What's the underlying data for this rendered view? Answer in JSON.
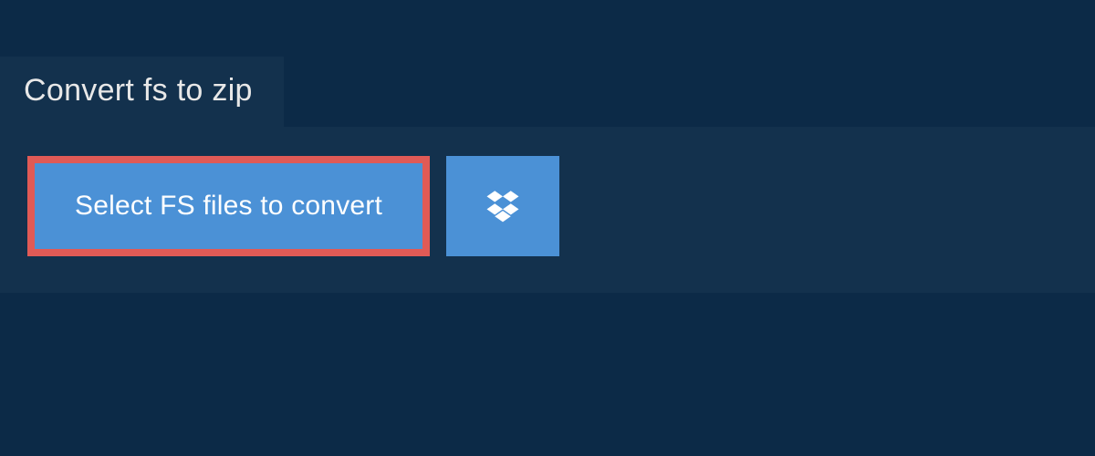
{
  "tab": {
    "label": "Convert fs to zip"
  },
  "actions": {
    "select_label": "Select FS files to convert"
  },
  "colors": {
    "page_bg": "#0c2a47",
    "panel_bg": "#13314d",
    "button_bg": "#4b91d6",
    "highlight_border": "#e05a56",
    "text_light": "#ffffff"
  }
}
